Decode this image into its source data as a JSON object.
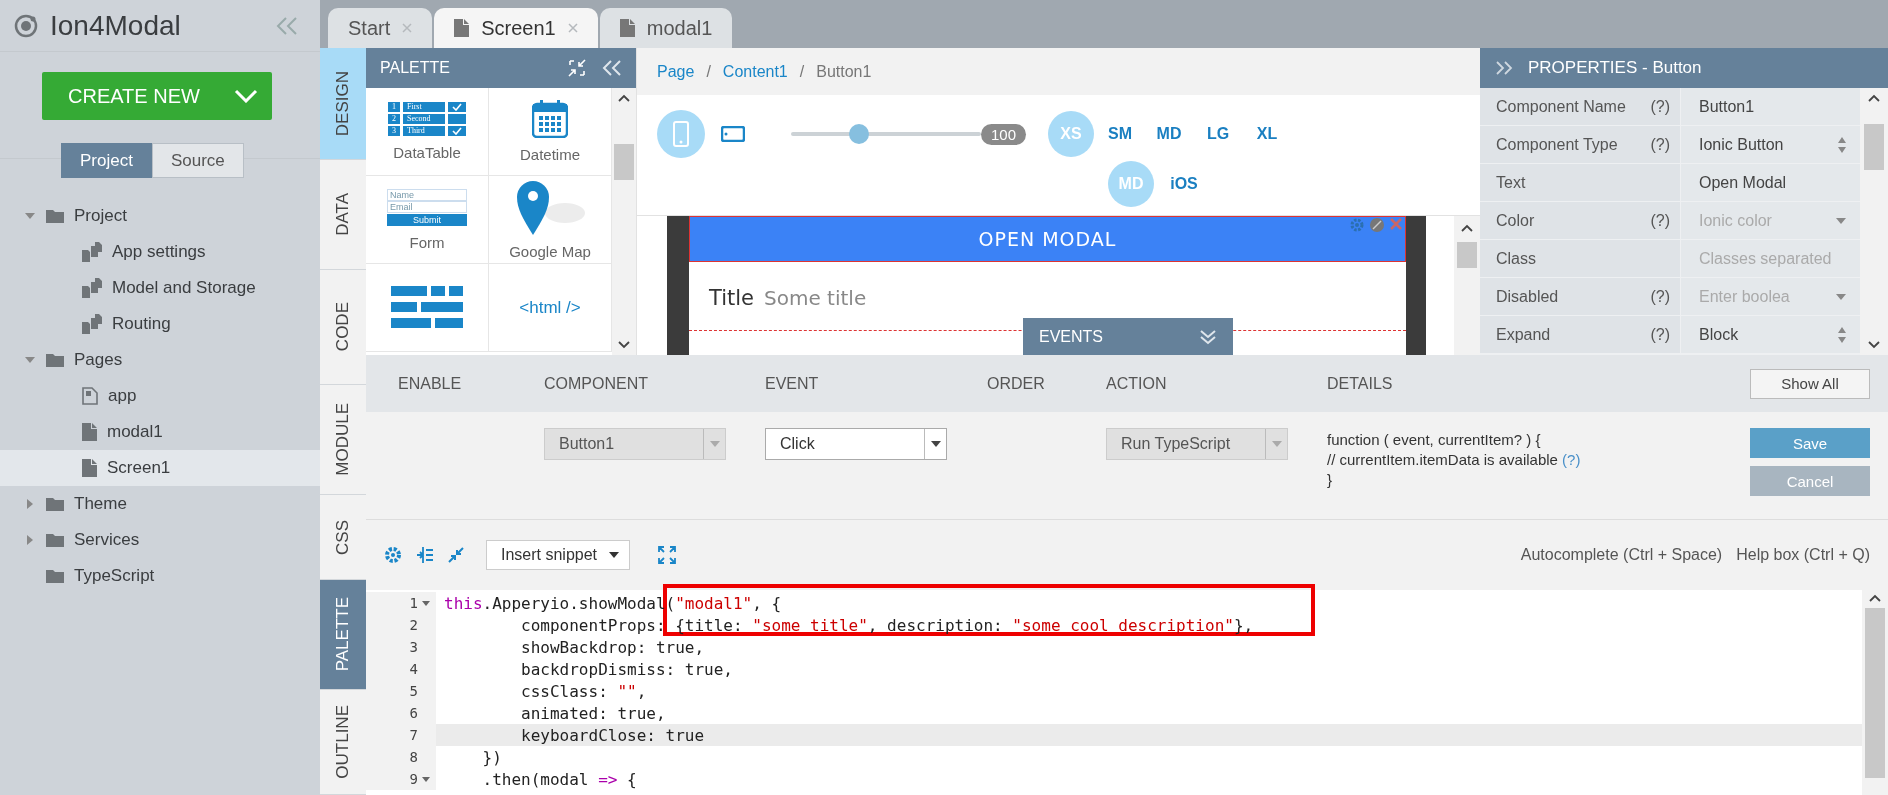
{
  "app": {
    "title": "Ion4Modal"
  },
  "create_button": {
    "label": "CREATE NEW"
  },
  "view_toggle": [
    {
      "label": "Project",
      "selected": true
    },
    {
      "label": "Source",
      "selected": false
    }
  ],
  "tree": [
    {
      "label": "Project",
      "kind": "folder",
      "expanded": true,
      "selected": false,
      "children": [
        {
          "label": "App settings",
          "kind": "settings",
          "selected": false
        },
        {
          "label": "Model and Storage",
          "kind": "settings",
          "selected": false
        },
        {
          "label": "Routing",
          "kind": "settings",
          "selected": false
        }
      ]
    },
    {
      "label": "Pages",
      "kind": "folder",
      "expanded": true,
      "selected": false,
      "children": [
        {
          "label": "app",
          "kind": "app-page",
          "selected": false
        },
        {
          "label": "modal1",
          "kind": "page",
          "selected": false
        },
        {
          "label": "Screen1",
          "kind": "page",
          "selected": true
        }
      ]
    },
    {
      "label": "Theme",
      "kind": "folder",
      "expanded": false,
      "selected": false
    },
    {
      "label": "Services",
      "kind": "folder",
      "expanded": false,
      "selected": false
    },
    {
      "label": "TypeScript",
      "kind": "empty-folder",
      "selected": false
    }
  ],
  "doc_tabs": [
    {
      "label": "Start",
      "kind": "start",
      "selected": false,
      "closable": true
    },
    {
      "label": "Screen1",
      "kind": "page",
      "selected": true,
      "closable": true
    },
    {
      "label": "modal1",
      "kind": "page",
      "selected": false,
      "closable": false
    }
  ],
  "side_tabs_upper": [
    {
      "label": "DESIGN",
      "selected": true
    },
    {
      "label": "DATA",
      "selected": false
    },
    {
      "label": "CODE",
      "selected": false
    },
    {
      "label": "MODULE",
      "selected": false
    }
  ],
  "side_tabs_lower": [
    {
      "label": "CSS",
      "selected": false
    },
    {
      "label": "PALETTE",
      "selected": true
    },
    {
      "label": "OUTLINE",
      "selected": false
    }
  ],
  "palette": {
    "title": "PALETTE",
    "items": [
      {
        "kind": "datatable",
        "label": "DataTable",
        "rows": [
          {
            "n": "1",
            "text": "First",
            "checked": true
          },
          {
            "n": "2",
            "text": "Second",
            "checked": false
          },
          {
            "n": "3",
            "text": "Third",
            "checked": true
          }
        ]
      },
      {
        "kind": "calendar",
        "label": "Datetime"
      },
      {
        "kind": "form",
        "label": "Form",
        "fields": [
          "Name",
          "Email"
        ],
        "submit": "Submit"
      },
      {
        "kind": "map",
        "label": "Google Map"
      },
      {
        "kind": "grid"
      },
      {
        "kind": "html",
        "text": "<html />"
      }
    ]
  },
  "canvas": {
    "breadcrumb": [
      {
        "label": "Page",
        "link": true
      },
      {
        "label": "Content1",
        "link": true
      },
      {
        "label": "Button1",
        "link": false
      }
    ],
    "separator": "/",
    "devices": [
      {
        "kind": "phone",
        "selected": true
      },
      {
        "kind": "tablet",
        "selected": false
      }
    ],
    "zoom": {
      "level": 0.36,
      "reading": "100"
    },
    "sizes": [
      {
        "label": "XS",
        "selected": true
      },
      {
        "label": "SM",
        "selected": false
      },
      {
        "label": "MD",
        "selected": false
      },
      {
        "label": "LG",
        "selected": false
      },
      {
        "label": "XL",
        "selected": false
      }
    ],
    "platforms": [
      {
        "label": "MD",
        "selected": true
      },
      {
        "label": "iOS",
        "selected": false
      }
    ],
    "preview": {
      "button": "OPEN MODAL",
      "title_label": "Title",
      "title_value": "Some title"
    },
    "events_tab": "EVENTS"
  },
  "properties": {
    "title": "PROPERTIES - Button",
    "rows": [
      {
        "label": "Component Name",
        "help": "(?)",
        "kind": "text",
        "value": "Button1"
      },
      {
        "label": "Component Type",
        "help": "(?)",
        "kind": "spinner",
        "value": "Ionic Button"
      },
      {
        "label": "Text",
        "kind": "text",
        "value": "Open Modal"
      },
      {
        "label": "Color",
        "help": "(?)",
        "kind": "dropdown",
        "placeholder": "Ionic color"
      },
      {
        "label": "Class",
        "kind": "text",
        "placeholder": "Classes separated"
      },
      {
        "label": "Disabled",
        "help": "(?)",
        "kind": "dropdown",
        "placeholder": "Enter boolea"
      },
      {
        "label": "Expand",
        "help": "(?)",
        "kind": "spinner",
        "value": "Block"
      }
    ]
  },
  "events": {
    "columns": [
      "ENABLE",
      "COMPONENT",
      "EVENT",
      "ORDER",
      "ACTION",
      "DETAILS"
    ],
    "show_all": "Show All",
    "row": {
      "component": {
        "value": "Button1",
        "disabled": true
      },
      "event": {
        "value": "Click",
        "disabled": false
      },
      "action": {
        "value": "Run TypeScript",
        "disabled": true
      },
      "details": [
        "function ( event, currentItem? ) {",
        "// currentItem.itemData is available",
        "}"
      ],
      "help": "(?)"
    },
    "buttons": [
      {
        "label": "Save",
        "disabled": false
      },
      {
        "label": "Cancel",
        "disabled": true
      }
    ]
  },
  "editor": {
    "snippet": "Insert snippet",
    "hints": [
      "Autocomplete (Ctrl + Space)",
      "Help box (Ctrl + Q)"
    ],
    "lines": [
      {
        "number": "1",
        "foldable": true,
        "highlighted": false,
        "tokens": [
          {
            "kind": "keyword",
            "text": "this"
          },
          {
            "kind": "plain",
            "text": ".Apperyio.showModal("
          },
          {
            "kind": "string",
            "text": "\"modal1\""
          },
          {
            "kind": "plain",
            "text": ", {"
          }
        ]
      },
      {
        "number": "2",
        "foldable": false,
        "highlighted": false,
        "tokens": [
          {
            "kind": "plain",
            "text": "        componentProps: {title: "
          },
          {
            "kind": "string",
            "text": "\"some title\""
          },
          {
            "kind": "plain",
            "text": ", description: "
          },
          {
            "kind": "string",
            "text": "\"some cool description\""
          },
          {
            "kind": "plain",
            "text": "},"
          }
        ]
      },
      {
        "number": "3",
        "foldable": false,
        "highlighted": false,
        "tokens": [
          {
            "kind": "plain",
            "text": "        showBackdrop: true,"
          }
        ]
      },
      {
        "number": "4",
        "foldable": false,
        "highlighted": false,
        "tokens": [
          {
            "kind": "plain",
            "text": "        backdropDismiss: true,"
          }
        ]
      },
      {
        "number": "5",
        "foldable": false,
        "highlighted": false,
        "tokens": [
          {
            "kind": "plain",
            "text": "        cssClass: "
          },
          {
            "kind": "string",
            "text": "\"\""
          },
          {
            "kind": "plain",
            "text": ","
          }
        ]
      },
      {
        "number": "6",
        "foldable": false,
        "highlighted": false,
        "tokens": [
          {
            "kind": "plain",
            "text": "        animated: true,"
          }
        ]
      },
      {
        "number": "7",
        "foldable": false,
        "highlighted": true,
        "tokens": [
          {
            "kind": "plain",
            "text": "        keyboardClose: true"
          }
        ]
      },
      {
        "number": "8",
        "foldable": false,
        "highlighted": false,
        "tokens": [
          {
            "kind": "plain",
            "text": "    })"
          }
        ]
      },
      {
        "number": "9",
        "foldable": true,
        "highlighted": false,
        "tokens": [
          {
            "kind": "plain",
            "text": "    .then(modal "
          },
          {
            "kind": "keyword",
            "text": "=>"
          },
          {
            "kind": "plain",
            "text": " {"
          }
        ]
      }
    ]
  }
}
